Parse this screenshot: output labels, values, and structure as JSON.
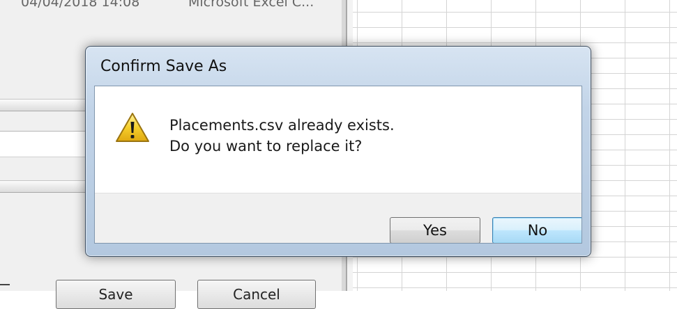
{
  "background": {
    "file_date": "04/04/2018 14:08",
    "file_type": "Microsoft Excel C...",
    "save_label": "Save",
    "cancel_label": "Cancel"
  },
  "dialog": {
    "title": "Confirm Save As",
    "icon": "warning-icon",
    "message_line1": "Placements.csv already exists.",
    "message_line2": "Do you want to replace it?",
    "yes_label": "Yes",
    "no_label": "No",
    "default_button": "No"
  },
  "colors": {
    "focus_border": "#3c7fb1",
    "warning_yellow": "#f3c11c",
    "frame_blue": "#c2d4e8"
  }
}
